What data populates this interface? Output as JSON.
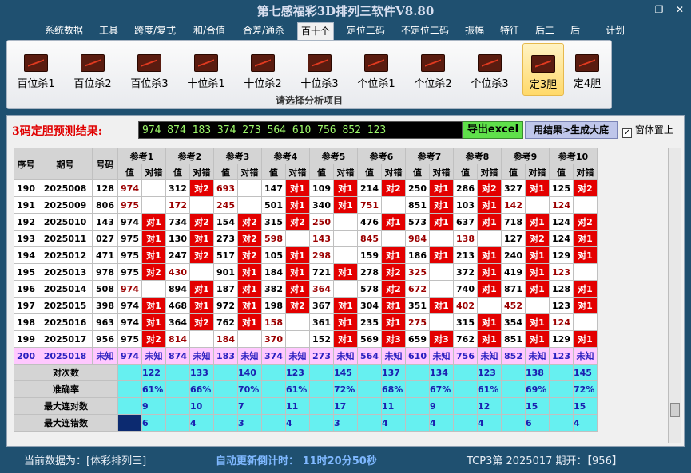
{
  "app": {
    "title": "第七感福彩3D排列三软件V8.80"
  },
  "menu": [
    "系统数据",
    "工具",
    "跨度/复式",
    "和/合值",
    "合差/通杀",
    "百十个",
    "定位二码",
    "不定位二码",
    "振幅",
    "特征",
    "后二",
    "后一",
    "计划"
  ],
  "menu_active": 5,
  "ribbon": {
    "buttons": [
      "百位杀1",
      "百位杀2",
      "百位杀3",
      "十位杀1",
      "十位杀2",
      "十位杀3",
      "个位杀1",
      "个位杀2",
      "个位杀3",
      "定3胆",
      "定4胆"
    ],
    "selected": 9,
    "group_caption": "请选择分析项目"
  },
  "prediction": {
    "label": "3码定胆预测结果:",
    "value": "974 874 183 374 273 564 610 756 852 123",
    "export_label": "导出excel",
    "generate_label": "用结果>生成大底",
    "pin_label": "窗体置上"
  },
  "table": {
    "col_headers": [
      "序号",
      "期号",
      "号码"
    ],
    "ref_headers": [
      "参考1",
      "参考2",
      "参考3",
      "参考4",
      "参考5",
      "参考6",
      "参考7",
      "参考8",
      "参考9",
      "参考10"
    ],
    "sub_headers": [
      "值",
      "对错"
    ],
    "rows": [
      {
        "seq": "190",
        "issue": "2025008",
        "num": "128",
        "cells": [
          [
            "974",
            "",
            0
          ],
          [
            "312",
            "对2",
            1
          ],
          [
            "693",
            "",
            0
          ],
          [
            "147",
            "对1",
            1
          ],
          [
            "109",
            "对1",
            1
          ],
          [
            "214",
            "对2",
            1
          ],
          [
            "250",
            "对1",
            1
          ],
          [
            "286",
            "对2",
            1
          ],
          [
            "327",
            "对1",
            1
          ],
          [
            "125",
            "对2",
            1
          ]
        ]
      },
      {
        "seq": "191",
        "issue": "2025009",
        "num": "806",
        "cells": [
          [
            "975",
            "",
            0
          ],
          [
            "172",
            "",
            0
          ],
          [
            "245",
            "",
            0
          ],
          [
            "501",
            "对1",
            1
          ],
          [
            "340",
            "对1",
            1
          ],
          [
            "751",
            "",
            0
          ],
          [
            "851",
            "对1",
            1
          ],
          [
            "103",
            "对1",
            1
          ],
          [
            "142",
            "",
            0
          ],
          [
            "124",
            "",
            0
          ]
        ]
      },
      {
        "seq": "192",
        "issue": "2025010",
        "num": "143",
        "cells": [
          [
            "974",
            "对1",
            1
          ],
          [
            "734",
            "对2",
            1
          ],
          [
            "154",
            "对2",
            1
          ],
          [
            "315",
            "对2",
            1
          ],
          [
            "250",
            "",
            0
          ],
          [
            "476",
            "对1",
            1
          ],
          [
            "573",
            "对1",
            1
          ],
          [
            "637",
            "对1",
            1
          ],
          [
            "718",
            "对1",
            1
          ],
          [
            "124",
            "对2",
            1
          ]
        ]
      },
      {
        "seq": "193",
        "issue": "2025011",
        "num": "027",
        "cells": [
          [
            "975",
            "对1",
            1
          ],
          [
            "130",
            "对1",
            1
          ],
          [
            "273",
            "对2",
            1
          ],
          [
            "598",
            "",
            0
          ],
          [
            "143",
            "",
            0
          ],
          [
            "845",
            "",
            0
          ],
          [
            "984",
            "",
            0
          ],
          [
            "138",
            "",
            0
          ],
          [
            "127",
            "对2",
            1
          ],
          [
            "124",
            "对1",
            1
          ]
        ]
      },
      {
        "seq": "194",
        "issue": "2025012",
        "num": "471",
        "cells": [
          [
            "975",
            "对1",
            1
          ],
          [
            "247",
            "对2",
            1
          ],
          [
            "517",
            "对2",
            1
          ],
          [
            "105",
            "对1",
            1
          ],
          [
            "298",
            "",
            0
          ],
          [
            "159",
            "对1",
            1
          ],
          [
            "186",
            "对1",
            1
          ],
          [
            "213",
            "对1",
            1
          ],
          [
            "240",
            "对1",
            1
          ],
          [
            "129",
            "对1",
            1
          ]
        ]
      },
      {
        "seq": "195",
        "issue": "2025013",
        "num": "978",
        "cells": [
          [
            "975",
            "对2",
            1
          ],
          [
            "430",
            "",
            0
          ],
          [
            "901",
            "对1",
            1
          ],
          [
            "184",
            "对1",
            1
          ],
          [
            "721",
            "对1",
            1
          ],
          [
            "278",
            "对2",
            1
          ],
          [
            "325",
            "",
            0
          ],
          [
            "372",
            "对1",
            1
          ],
          [
            "419",
            "对1",
            1
          ],
          [
            "123",
            "",
            0
          ]
        ]
      },
      {
        "seq": "196",
        "issue": "2025014",
        "num": "508",
        "cells": [
          [
            "974",
            "",
            0
          ],
          [
            "894",
            "对1",
            1
          ],
          [
            "187",
            "对1",
            1
          ],
          [
            "382",
            "对1",
            1
          ],
          [
            "364",
            "",
            0
          ],
          [
            "578",
            "对2",
            1
          ],
          [
            "672",
            "",
            0
          ],
          [
            "740",
            "对1",
            1
          ],
          [
            "871",
            "对1",
            1
          ],
          [
            "128",
            "对1",
            1
          ]
        ]
      },
      {
        "seq": "197",
        "issue": "2025015",
        "num": "398",
        "cells": [
          [
            "974",
            "对1",
            1
          ],
          [
            "468",
            "对1",
            1
          ],
          [
            "972",
            "对1",
            1
          ],
          [
            "198",
            "对2",
            1
          ],
          [
            "367",
            "对1",
            1
          ],
          [
            "304",
            "对1",
            1
          ],
          [
            "351",
            "对1",
            1
          ],
          [
            "402",
            "",
            0
          ],
          [
            "452",
            "",
            0
          ],
          [
            "123",
            "对1",
            1
          ]
        ]
      },
      {
        "seq": "198",
        "issue": "2025016",
        "num": "963",
        "cells": [
          [
            "974",
            "对1",
            1
          ],
          [
            "364",
            "对2",
            1
          ],
          [
            "762",
            "对1",
            1
          ],
          [
            "158",
            "",
            0
          ],
          [
            "361",
            "对1",
            1
          ],
          [
            "235",
            "对1",
            1
          ],
          [
            "275",
            "",
            0
          ],
          [
            "315",
            "对1",
            1
          ],
          [
            "354",
            "对1",
            1
          ],
          [
            "124",
            "",
            0
          ]
        ]
      },
      {
        "seq": "199",
        "issue": "2025017",
        "num": "956",
        "cells": [
          [
            "975",
            "对2",
            1
          ],
          [
            "814",
            "",
            0
          ],
          [
            "184",
            "",
            0
          ],
          [
            "370",
            "",
            0
          ],
          [
            "152",
            "对1",
            1
          ],
          [
            "569",
            "对3",
            1
          ],
          [
            "659",
            "对3",
            1
          ],
          [
            "762",
            "对1",
            1
          ],
          [
            "851",
            "对1",
            1
          ],
          [
            "129",
            "对1",
            1
          ]
        ]
      },
      {
        "seq": "200",
        "issue": "2025018",
        "num": "未知",
        "cells": [
          [
            "974",
            "未知",
            0
          ],
          [
            "874",
            "未知",
            0
          ],
          [
            "183",
            "未知",
            0
          ],
          [
            "374",
            "未知",
            0
          ],
          [
            "273",
            "未知",
            0
          ],
          [
            "564",
            "未知",
            0
          ],
          [
            "610",
            "未知",
            0
          ],
          [
            "756",
            "未知",
            0
          ],
          [
            "852",
            "未知",
            0
          ],
          [
            "123",
            "未知",
            0
          ]
        ]
      }
    ],
    "stats": [
      {
        "label": "对次数",
        "values": [
          "122",
          "133",
          "140",
          "123",
          "145",
          "137",
          "134",
          "123",
          "138",
          "145"
        ]
      },
      {
        "label": "准确率",
        "values": [
          "61%",
          "66%",
          "70%",
          "61%",
          "72%",
          "68%",
          "67%",
          "61%",
          "69%",
          "72%"
        ]
      },
      {
        "label": "最大连对数",
        "values": [
          "9",
          "10",
          "7",
          "11",
          "17",
          "11",
          "9",
          "12",
          "15",
          "15"
        ]
      },
      {
        "label": "最大连错数",
        "values": [
          "6",
          "4",
          "3",
          "4",
          "3",
          "4",
          "4",
          "4",
          "6",
          "4"
        ]
      }
    ]
  },
  "status": {
    "current": "当前数据为：[体彩排列三]",
    "countdown": "自动更新倒计时： 11时20分50秒",
    "issue": "TCP3第 2025017 期开：【956】"
  },
  "colors": {
    "hit": "#e30000",
    "miss_value": "#9b0000",
    "stat_bg": "#66f0f0",
    "last_row_bg": "#ffc8ff"
  }
}
